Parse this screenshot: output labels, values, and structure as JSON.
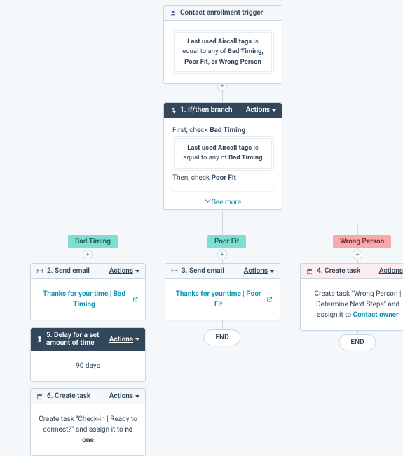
{
  "trigger": {
    "title": "Contact enrollment trigger",
    "criteria_prefix": "Last used Aircall tags",
    "criteria_middle": " is equal to any of ",
    "criteria_values": "Bad Timing, Poor Fit, or Wrong Person"
  },
  "branch": {
    "title": "1. If/then branch",
    "actions_label": "Actions",
    "first_label": "First, check ",
    "first_value": "Bad Timing",
    "crit_prefix": "Last used Aircall tags",
    "crit_middle": " is equal to any of ",
    "crit_value": "Bad Timing",
    "then_label": "Then, check ",
    "then_value": "Poor Fit",
    "see_more": "See more"
  },
  "labels": {
    "bad_timing": "Bad Timing",
    "poor_fit": "Poor Fit",
    "wrong_person": "Wrong Person"
  },
  "step2": {
    "title": "2. Send email",
    "actions": "Actions",
    "link": "Thanks for your time | Bad Timing"
  },
  "step3": {
    "title": "3. Send email",
    "actions": "Actions",
    "link": "Thanks for your time | Poor Fit"
  },
  "step4": {
    "title": "4. Create task",
    "actions": "Actions",
    "body_prefix": "Create task \"Wrong Person | Determine Next Steps\" and assign it to ",
    "body_link": "Contact owner"
  },
  "step5": {
    "title": "5. Delay for a set amount of time",
    "actions": "Actions",
    "body": "90 days"
  },
  "step6": {
    "title": "6. Create task",
    "actions": "Actions",
    "body_prefix": "Create task \"Check-in | Ready to connect?\" and assign it to ",
    "body_bold": "no one"
  },
  "end": "END"
}
